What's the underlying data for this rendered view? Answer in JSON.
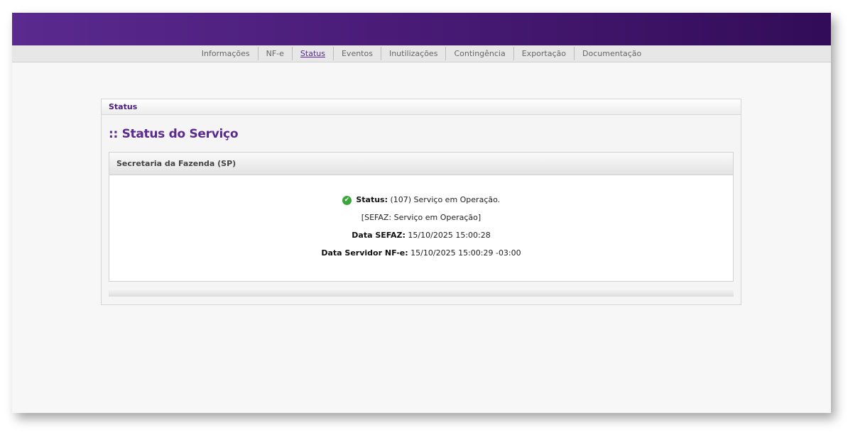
{
  "nav": {
    "items": [
      {
        "label": "Informações"
      },
      {
        "label": "NF-e"
      },
      {
        "label": "Status"
      },
      {
        "label": "Eventos"
      },
      {
        "label": "Inutilizações"
      },
      {
        "label": "Contingência"
      },
      {
        "label": "Exportação"
      },
      {
        "label": "Documentação"
      }
    ],
    "active": "Status"
  },
  "panel": {
    "header": "Status",
    "section_title": ":: Status do Serviço"
  },
  "box": {
    "header": "Secretaria da Fazenda (SP)",
    "status_label": "Status:",
    "status_value": "(107) Serviço em Operação.",
    "sefaz_message": "[SEFAZ: Serviço em Operação]",
    "data_sefaz_label": "Data SEFAZ:",
    "data_sefaz_value": "15/10/2025 15:00:28",
    "data_servidor_label": "Data Servidor NF-e:",
    "data_servidor_value": "15/10/2025 15:00:29 -03:00"
  },
  "colors": {
    "brand": "#5a2a8f",
    "status_ok": "#3aa63a"
  },
  "icons": {
    "status": "check-circle-icon"
  }
}
